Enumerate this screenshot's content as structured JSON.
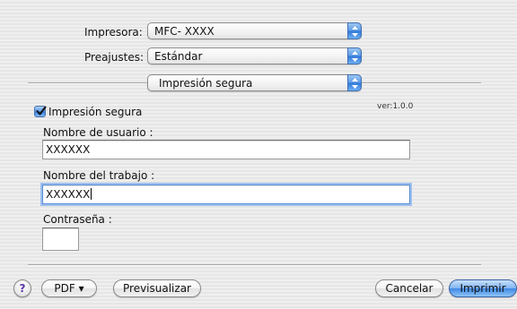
{
  "printer": {
    "label": "Impresora:",
    "value": "MFC- XXXX"
  },
  "presets": {
    "label": "Preajustes:",
    "value": "Estándar"
  },
  "panel": {
    "value": "Impresión segura"
  },
  "version": "ver:1.0.0",
  "secure_print": {
    "label": "Impresión segura",
    "checked": true
  },
  "user_name": {
    "label": "Nombre de usuario :",
    "value": "XXXXXX"
  },
  "job_name": {
    "label": "Nombre del trabajo :",
    "value": "XXXXXX"
  },
  "password": {
    "label": "Contraseña :",
    "value": ""
  },
  "footer": {
    "help": "?",
    "pdf": "PDF ▾",
    "preview": "Previsualizar",
    "cancel": "Cancelar",
    "print": "Imprimir"
  }
}
